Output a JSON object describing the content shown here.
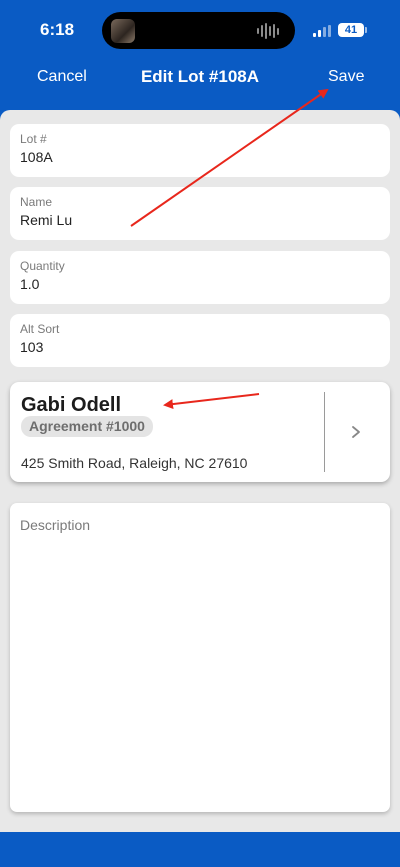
{
  "status_bar": {
    "time": "6:18",
    "battery": "41"
  },
  "nav": {
    "cancel_label": "Cancel",
    "title": "Edit Lot #108A",
    "save_label": "Save"
  },
  "fields": {
    "lot_number": {
      "label": "Lot #",
      "value": "108A"
    },
    "name": {
      "label": "Name",
      "value": "Remi Lu"
    },
    "quantity": {
      "label": "Quantity",
      "value": "1.0"
    },
    "alt_sort": {
      "label": "Alt Sort",
      "value": "103"
    }
  },
  "contact_card": {
    "name": "Gabi Odell",
    "agreement": "Agreement #1000",
    "address": "425 Smith Road, Raleigh, NC 27610",
    "chevron_icon": "chevron-right-icon"
  },
  "description": {
    "placeholder": "Description"
  },
  "colors": {
    "nav_background": "#0a5bc4",
    "content_background": "#e8e8e8",
    "annotation_arrow": "#e8271c"
  }
}
